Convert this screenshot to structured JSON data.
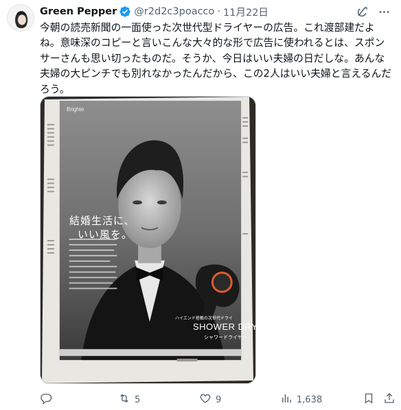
{
  "tweet": {
    "author": {
      "name": "Green Pepper",
      "handle": "@r2d2c3poacco",
      "separator": "·",
      "date": "11月22日"
    },
    "text": "今朝の読売新聞の一面使った次世代型ドライヤーの広告。これ渡部建だよね。意味深のコピーと言いこんな大々的な形で広告に使われるとは、スポンサーさんも思い切ったものだ。そうか、今日はいい夫婦の日だしな。あんな夫婦の大ピンチでも別れなかったんだから、この2人はいい夫婦と言えるんだろう。",
    "image": {
      "brand": "Brighte",
      "headline_line1": "結婚生活に、",
      "headline_line2": "いい風を。",
      "product_sub": "ハイエンド搭載の次世代ドライ",
      "product_name": "SHOWER DRY",
      "product_kana": "シャワードライヤー"
    },
    "actions": {
      "reply_count": "",
      "repost_count": "5",
      "like_count": "9",
      "views_count": "1,638"
    }
  },
  "icons": {
    "verified": "verified-badge-icon",
    "grok": "grok-icon",
    "more": "more-icon",
    "reply": "reply-icon",
    "repost": "repost-icon",
    "like": "heart-icon",
    "views": "views-icon",
    "bookmark": "bookmark-icon",
    "share": "share-icon"
  },
  "colors": {
    "text": "#0f1419",
    "secondary": "#536471",
    "verified": "#1d9bf0"
  }
}
